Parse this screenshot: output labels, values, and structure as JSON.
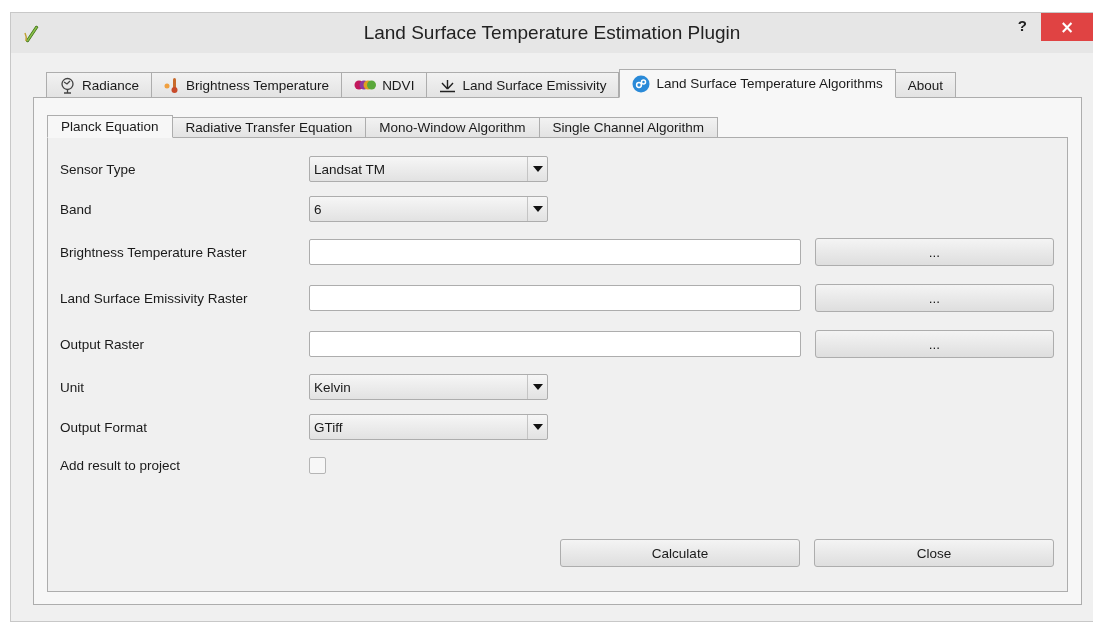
{
  "window": {
    "title": "Land Surface Temperature Estimation Plugin",
    "help": "?",
    "close": "×"
  },
  "tabs": [
    {
      "label": "Radiance",
      "selected": false
    },
    {
      "label": "Brightness Temperature",
      "selected": false
    },
    {
      "label": "NDVI",
      "selected": false
    },
    {
      "label": "Land Surface Emissivity",
      "selected": false
    },
    {
      "label": "Land Surface Temperature Algorithms",
      "selected": true
    },
    {
      "label": "About",
      "selected": false
    }
  ],
  "subtabs": [
    {
      "label": "Planck Equation",
      "selected": true
    },
    {
      "label": "Radiative Transfer Equation",
      "selected": false
    },
    {
      "label": "Mono-Window Algorithm",
      "selected": false
    },
    {
      "label": "Single Channel Algorithm",
      "selected": false
    }
  ],
  "form": [
    {
      "kind": "combo",
      "label": "Sensor Type",
      "value": "Landsat TM"
    },
    {
      "kind": "combo",
      "label": "Band",
      "value": "6"
    },
    {
      "kind": "file",
      "label": "Brightness Temperature Raster",
      "button": "..."
    },
    {
      "kind": "file",
      "label": "Land Surface Emissivity Raster",
      "button": "..."
    },
    {
      "kind": "file",
      "label": "Output Raster",
      "button": "..."
    },
    {
      "kind": "combo",
      "label": "Unit",
      "value": "Kelvin"
    },
    {
      "kind": "combo",
      "label": "Output Format",
      "value": "GTiff"
    },
    {
      "kind": "checkbox",
      "label": "Add result to project",
      "checked": false
    }
  ],
  "buttons": [
    "Calculate",
    "Close"
  ]
}
